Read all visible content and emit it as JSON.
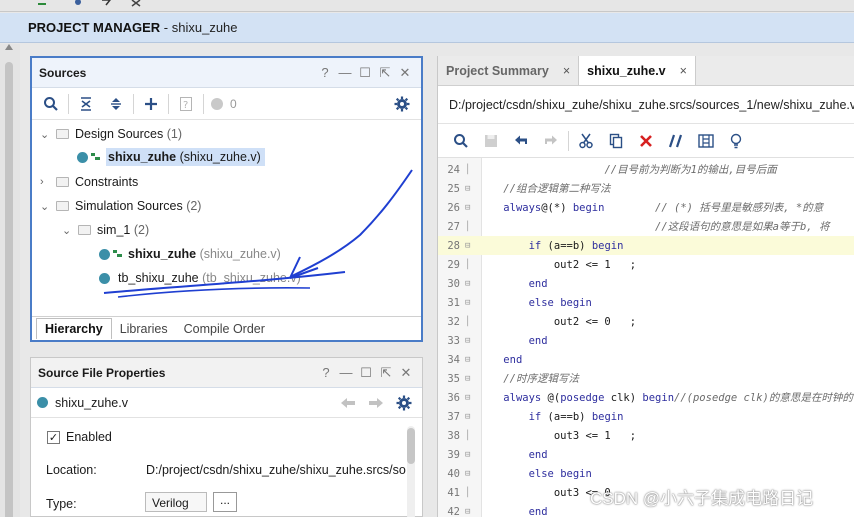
{
  "window": {
    "title": "PROJECT MANAGER",
    "subtitle": " - shixu_zuhe"
  },
  "sources": {
    "title": "Sources",
    "controls": [
      "?",
      "—",
      "☐",
      "⇱",
      "✕"
    ],
    "toolbar": {
      "count": "0"
    },
    "tree": {
      "design": {
        "label": "Design Sources",
        "count": "(1)"
      },
      "design_file": {
        "name": "shixu_zuhe",
        "file": "(shixu_zuhe.v)"
      },
      "constraints": {
        "label": "Constraints"
      },
      "simulation": {
        "label": "Simulation Sources",
        "count": "(2)"
      },
      "sim_1": {
        "label": "sim_1",
        "count": "(2)"
      },
      "sim_file1": {
        "name": "shixu_zuhe",
        "file": "(shixu_zuhe.v)"
      },
      "sim_file2": {
        "name": "tb_shixu_zuhe",
        "file": "(tb_shixu_zuhe.v)"
      }
    },
    "tabs": [
      "Hierarchy",
      "Libraries",
      "Compile Order"
    ]
  },
  "properties": {
    "title": "Source File Properties",
    "file": "shixu_zuhe.v",
    "enabled_label": "Enabled",
    "location_label": "Location:",
    "location_value": "D:/project/csdn/shixu_zuhe/shixu_zuhe.srcs/sou",
    "type_label": "Type:",
    "type_value": "Verilog",
    "more": "..."
  },
  "editor": {
    "tabs": [
      {
        "label": "Project Summary"
      },
      {
        "label": "shixu_zuhe.v"
      }
    ],
    "tab_close": "×",
    "path": "D:/project/csdn/shixu_zuhe/shixu_zuhe.srcs/sources_1/new/shixu_zuhe.v",
    "lines": [
      {
        "n": "24",
        "t": "                    //目号前为判断为1的输出,目号后面"
      },
      {
        "n": "25",
        "t": "    //组合逻辑第二种写法"
      },
      {
        "n": "26",
        "t": "    always@(*) begin        // (*) 括号里是敏感列表, *的意"
      },
      {
        "n": "27",
        "t": "                            //这段语句的意思是如果a等于b, 将"
      },
      {
        "n": "28",
        "t": "        if (a==b) begin"
      },
      {
        "n": "29",
        "t": "            out2 <= 1   ;"
      },
      {
        "n": "30",
        "t": "        end"
      },
      {
        "n": "31",
        "t": "        else begin"
      },
      {
        "n": "32",
        "t": "            out2 <= 0   ;"
      },
      {
        "n": "33",
        "t": "        end"
      },
      {
        "n": "34",
        "t": "    end"
      },
      {
        "n": "35",
        "t": "    //时序逻辑写法"
      },
      {
        "n": "36",
        "t": "    always @(posedge clk) begin//(posedge clk)的意思是在时钟的"
      },
      {
        "n": "37",
        "t": "        if (a==b) begin"
      },
      {
        "n": "38",
        "t": "            out3 <= 1   ;"
      },
      {
        "n": "39",
        "t": "        end"
      },
      {
        "n": "40",
        "t": "        else begin"
      },
      {
        "n": "41",
        "t": "            out3 <= 0"
      },
      {
        "n": "42",
        "t": "        end"
      }
    ]
  },
  "watermark": "CSDN @小六子集成电路日记",
  "colors": {
    "accent": "#4a7cc7",
    "highlight": "#fbfbd9",
    "ink": "#1f3fd1"
  }
}
